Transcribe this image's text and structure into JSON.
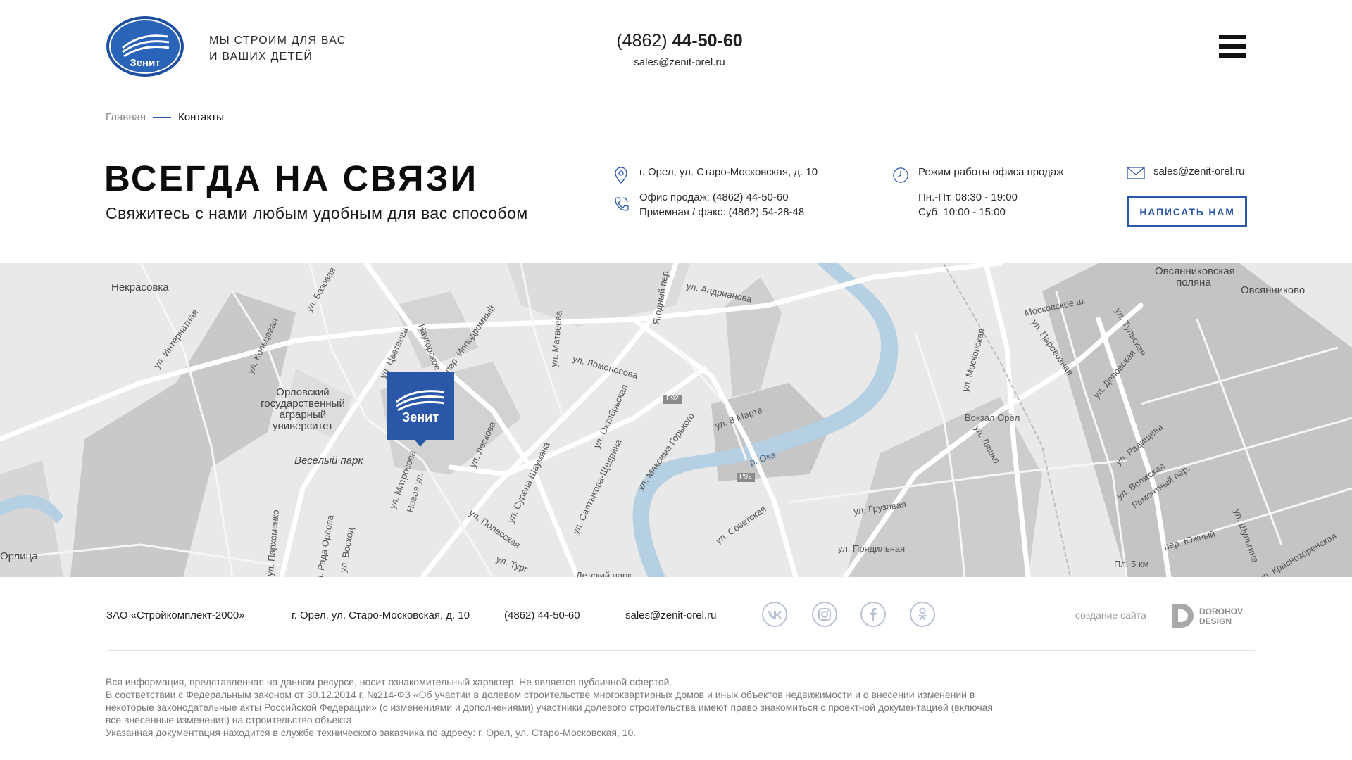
{
  "header": {
    "tagline_line1": "МЫ СТРОИМ ДЛЯ ВАС",
    "tagline_line2": "И ВАШИХ ДЕТЕЙ",
    "logo_text": "Зенит",
    "phone_code": "(4862)",
    "phone_number": "44-50-60",
    "email": "sales@zenit-orel.ru",
    "menu_icon": "hamburger-icon"
  },
  "breadcrumb": {
    "home": "Главная",
    "current": "Контакты"
  },
  "hero": {
    "title": "ВСЕГДА НА СВЯЗИ",
    "subtitle": "Свяжитесь с нами любым удобным для вас способом"
  },
  "contacts": {
    "address": "г. Орел, ул. Старо-Московская, д. 10",
    "office_phone": "Офис продаж: (4862) 44-50-60",
    "fax": "Приемная / факс: (4862) 54-28-48",
    "hours_title": "Режим работы офиса продаж",
    "hours_weekdays": "Пн.-Пт. 08:30 - 19:00",
    "hours_saturday": "Суб. 10:00 - 15:00",
    "email": "sales@zenit-orel.ru",
    "write_button": "НАПИСАТЬ НАМ"
  },
  "map": {
    "marker_text": "Зенит",
    "labels": {
      "nekrasovka": "Некрасовка",
      "ovsyannikovskaya": "Овсянниковская поляна",
      "ovsyannikovo": "Овсянниково",
      "university": "Орловский государственный аграрный университет",
      "vesely_park": "Веселый парк",
      "river": "р. Ока",
      "station": "Вокзал Орёл",
      "road_p92_a": "Р92",
      "road_p92_b": "Р92",
      "orlitsa": "Орлица",
      "km5": "Пл. 5 км",
      "internatnaya": "ул. Интернатная",
      "kolchuzh": "ул. Кольцевая",
      "bazovaya": "ул. Базовая",
      "tsvetaeva": "ул. Цветаева",
      "naugorskoe": "Наугорское ш.",
      "ippodromny": "пер. Ипподромный",
      "matveeva": "ул. Матвеева",
      "yagodny": "Ягодный пер.",
      "andrianova": "ул. Андрианова",
      "lomonosova": "ул. Ломоносова",
      "oktyabrskaya": "ул. Октябрьская",
      "marta": "ул. 8 Марта",
      "moskovskoe": "Московское ш.",
      "parovoznaya": "ул. Паровозная",
      "tulskaya": "ул. Тульская",
      "dekovskaya": "ул. Деповская",
      "radishcheva": "ул. Радищева",
      "volzhskaya": "ул. Волжская",
      "remontny": "Ремонтный пер.",
      "leskova": "ул. Лескова",
      "shaumyana": "ул. Сурена Шаумяна",
      "saltykova": "ул. Салтыкова-Щедрина",
      "gorkogo": "ул. Максима Горького",
      "moskovskaya": "ул. Московская",
      "lyashko": "ул. Ляшко",
      "gruzovaya": "ул. Грузовая",
      "pryadilnaya": "ул. Прядильная",
      "sovetskaya": "ул. Советская",
      "polesskaya": "ул. Полесская",
      "matrosova": "ул. Матросова",
      "novaya": "Новая ул.",
      "parkhomenko": "ул. Пархоменко",
      "yuzhny": "пер. Южный",
      "shulgina": "ул. Шульгина",
      "krasnozorenskaya": "ул. Краснозоренская",
      "turgeneva": "ул. Тург",
      "detsky_park": "Детский парк",
      "voskhod": "ул. Восход",
      "radio": "ул. Рада Орлова"
    }
  },
  "footer": {
    "company": "ЗАО «Стройкомплект-2000»",
    "address": "г. Орел, ул. Старо-Московская, д. 10",
    "phone": "(4862) 44-50-60",
    "email": "sales@zenit-orel.ru",
    "social": [
      "vk-icon",
      "instagram-icon",
      "facebook-icon",
      "odnoklassniki-icon"
    ],
    "credit": "создание сайта —",
    "dorohov_line1": "DOROHOV",
    "dorohov_line2": "DESIGN",
    "disclaimer": [
      "Вся информация, представленная на данном ресурсе, носит ознакомительный характер. Не является публичной офертой.",
      "В соответствии с Федеральным законом от 30.12.2014 г. №214-ФЗ «Об участии в долевом строительстве многоквартирных домов и иных объектов недвижимости и о внесении изменений в некоторые законодательные акты Российской Федерации» (с изменениями и дополнениями) участники долевого строительства имеют право знакомиться с проектной документацией (включая все внесенные изменения) на строительство объекта.",
      "Указанная документация находится в службе технического заказчика по адресу: г. Орел, ул. Старо-Московская, 10."
    ]
  },
  "colors": {
    "brand_blue": "#2a57a8",
    "map_bg": "#e8e8e8",
    "river": "#b5d0e3"
  }
}
